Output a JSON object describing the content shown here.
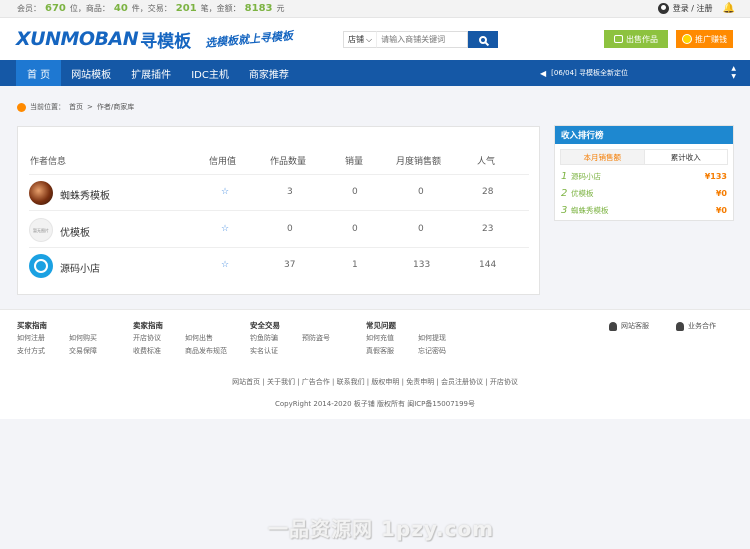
{
  "topbar": {
    "members_label": "会员：",
    "members_count": "670",
    "members_unit": "位，商品：",
    "products_count": "40",
    "products_unit": "件，交易：",
    "trades_count": "201",
    "trades_unit": "笔，金额：",
    "amount": "8183",
    "amount_unit": "元",
    "login_text": "登录 / 注册"
  },
  "header": {
    "logo_en": "XUNMOBAN",
    "logo_cn": "寻模板",
    "slogan": "选模板就上寻模板",
    "search_type": "店铺",
    "search_placeholder": "请输入商铺关键词",
    "sell_button": "出售作品",
    "promo_button": "推广赚钱"
  },
  "nav": {
    "items": [
      "首 页",
      "网站模板",
      "扩展插件",
      "IDC主机",
      "商家推荐"
    ],
    "notice": "[06/04] 寻模板全新定位"
  },
  "breadcrumb": {
    "label": "当前位置：",
    "home": "首页",
    "sep": " > ",
    "current": "作者/商家库"
  },
  "table": {
    "headers": [
      "作者信息",
      "信用值",
      "作品数量",
      "销量",
      "月度销售额",
      "人气"
    ],
    "rows": [
      {
        "name": "蜘蛛秀模板",
        "credit": "☆",
        "works": "3",
        "sales": "0",
        "monthly": "0",
        "popularity": "28"
      },
      {
        "name": "优模板",
        "credit": "☆",
        "works": "0",
        "sales": "0",
        "monthly": "0",
        "popularity": "23"
      },
      {
        "name": "源码小店",
        "credit": "☆",
        "works": "37",
        "sales": "1",
        "monthly": "133",
        "popularity": "144"
      }
    ],
    "avatar2_text": "暂无图片"
  },
  "ranking": {
    "title": "收入排行榜",
    "tabs": [
      "本月销售额",
      "累计收入"
    ],
    "items": [
      {
        "rank": "1",
        "name": "源码小店",
        "amount": "¥133"
      },
      {
        "rank": "2",
        "name": "优模板",
        "amount": "¥0"
      },
      {
        "rank": "3",
        "name": "蜘蛛秀模板",
        "amount": "¥0"
      }
    ]
  },
  "footer": {
    "columns": [
      {
        "title": "买家指南",
        "links": [
          "如何注册",
          "如何购买",
          "支付方式",
          "交易保障"
        ]
      },
      {
        "title": "卖家指南",
        "links": [
          "开店协议",
          "如何出售",
          "收费标准",
          "商品发布规范"
        ]
      },
      {
        "title": "安全交易",
        "links": [
          "钓鱼防骗",
          "预防盗号",
          "实名认证"
        ]
      },
      {
        "title": "常见问题",
        "links": [
          "如何充值",
          "如何提现",
          "真假客服",
          "忘记密码"
        ]
      }
    ],
    "service1": "网站客服",
    "service2": "业务合作",
    "links": "网站首页 | 关于我们 | 广告合作 | 联系我们 | 版权申明 | 免责申明 | 会员注册协议 | 开店协议",
    "copyright": "CopyRight 2014-2020 板子铺 版权所有 闽ICP备15007199号"
  },
  "watermark": "一品资源网 1pzy.com"
}
